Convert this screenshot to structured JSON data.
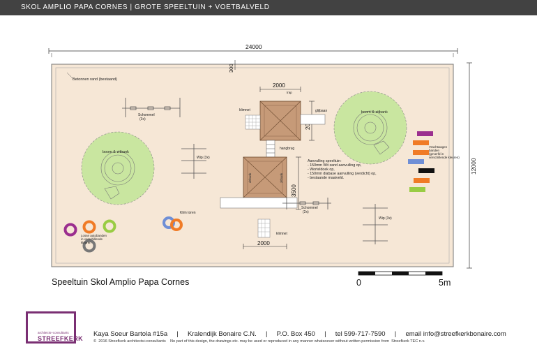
{
  "header": {
    "title": "SKOL AMPLIO PAPA CORNES | GROTE SPEELTUIN + VOETBALVELD"
  },
  "plan": {
    "dimensions": {
      "overall_width": "24000",
      "overall_height": "12000",
      "edge_offset": "300",
      "top_width": "2000",
      "top_height": "2000",
      "tower_height": "3500",
      "bottom_width": "2000"
    },
    "labels": {
      "border": "Betonnen rand (bestaand)",
      "swing_left": "Schommel\n(3x)",
      "tree_left": "boom & zitbank",
      "seesaw_left": "Wip (3x)",
      "loose_tires": "Losse autobanden\nin verschillende\nkleuren",
      "climb_tower": "Klim toren",
      "climb_net_top": "klimnet",
      "climb_net_bottom": "klimnet",
      "trap": "trap",
      "slide": "glijbaan",
      "hang_bridge": "hangbrug",
      "tower_text": "zitbank",
      "fill_notes": "Aanvulling speeltuin:\n- 150mm Wit zand aanvulling op,\n- Worteldoek op,\n- 150mm diabase aanvulling (verdicht) op,\n- bestaande maaiveld.",
      "swing_right": "Schommel\n(2x)",
      "tree_right": "boom & zitbank",
      "truck_tires": "Vrachtwagen\nbanden\n(geverfd in\nverschillende kleuren)",
      "seesaw_right": "Wip (3x)"
    }
  },
  "caption": "Speeltuin Skol Amplio Papa Cornes",
  "scale": {
    "zero": "0",
    "five": "5m"
  },
  "logo": {
    "small": "architects+consultants",
    "name": "STREEFKERK"
  },
  "footer": {
    "contact": "Kaya Soeur Bartola #15a     |     Kralendijk Bonaire C.N.     |     P.O. Box 450     |     tel 599-717-7590     |     email info@streefkerkbonaire.com",
    "copyright": "©  2016 Streefkerk architects+consultants    No part of this design, the drawings etc. may be used or reproduced in any manner whatsoever without written permission from  Streefkerk TEC n.v."
  },
  "colors": {
    "sand": "#f6e7d6",
    "grass": "#c9e6a0",
    "roof": "#c69a78",
    "purple": "#9b2f8f",
    "orange": "#f07b26",
    "lime": "#99cc44",
    "blue": "#6f8fd6",
    "red": "#e2231a",
    "black": "#111111"
  }
}
